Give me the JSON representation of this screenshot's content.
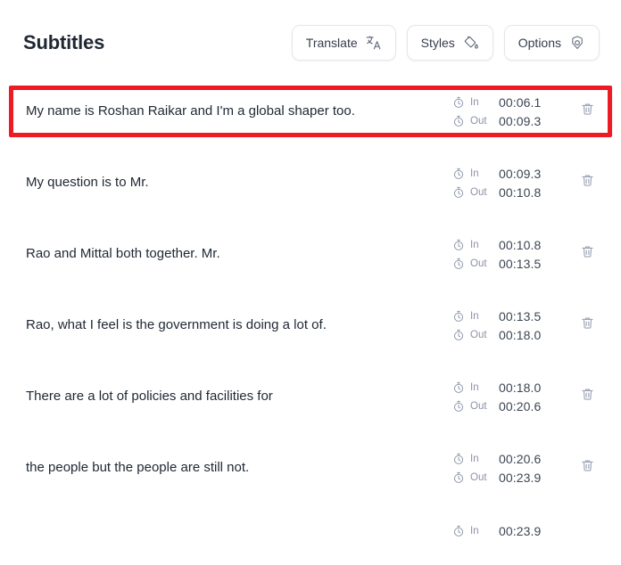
{
  "header": {
    "title": "Subtitles",
    "actions": [
      {
        "label": "Translate",
        "icon": "translate-icon"
      },
      {
        "label": "Styles",
        "icon": "paint-bucket-icon"
      },
      {
        "label": "Options",
        "icon": "settings-gear-icon"
      }
    ]
  },
  "list": {
    "in_label": "In",
    "out_label": "Out",
    "rows": [
      {
        "text": "My name is Roshan Raikar and I'm a global shaper too.",
        "in": "00:06.1",
        "out": "00:09.3",
        "highlighted": true
      },
      {
        "text": "My question is to Mr.",
        "in": "00:09.3",
        "out": "00:10.8",
        "highlighted": false
      },
      {
        "text": "Rao and Mittal both together. Mr.",
        "in": "00:10.8",
        "out": "00:13.5",
        "highlighted": false
      },
      {
        "text": "Rao, what I feel is the government is doing a lot of.",
        "in": "00:13.5",
        "out": "00:18.0",
        "highlighted": false
      },
      {
        "text": "There are a lot of policies and facilities for",
        "in": "00:18.0",
        "out": "00:20.6",
        "highlighted": false
      },
      {
        "text": "the people but the people are still not.",
        "in": "00:20.6",
        "out": "00:23.9",
        "highlighted": false
      },
      {
        "text": "",
        "in": "00:23.9",
        "out": "",
        "highlighted": false
      }
    ]
  },
  "colors": {
    "highlight_border": "#ed1c24",
    "text_primary": "#1f2733",
    "text_muted": "#8b93a5"
  }
}
